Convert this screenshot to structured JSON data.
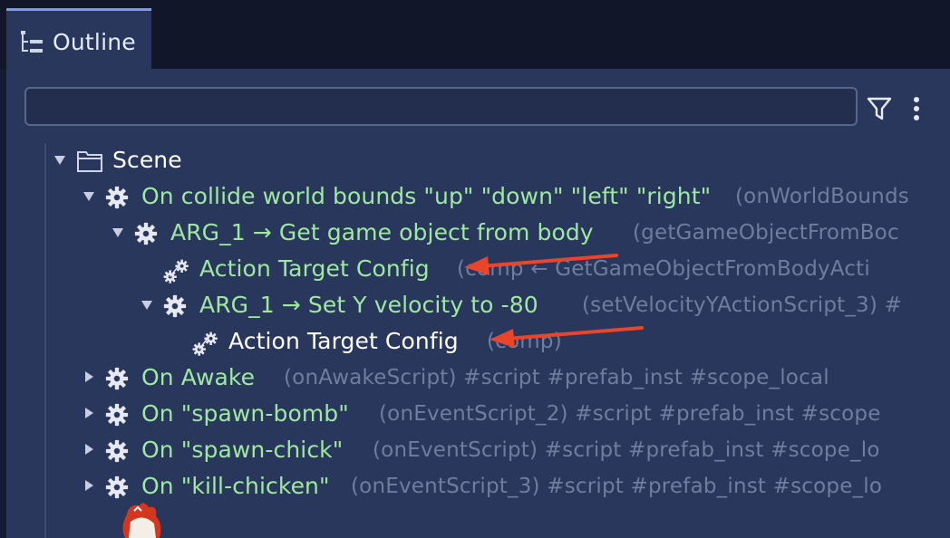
{
  "tab": {
    "label": "Outline"
  },
  "search": {
    "value": "",
    "placeholder": ""
  },
  "tree": {
    "scene": "Scene",
    "rows": [
      {
        "label": "On collide world bounds \"up\" \"down\" \"left\" \"right\"",
        "meta": "(onWorldBounds"
      },
      {
        "label": "ARG_1 → Get game object from body",
        "meta": "(getGameObjectFromBoc"
      },
      {
        "label": "Action Target Config",
        "meta": "(comp ← GetGameObjectFromBodyActi"
      },
      {
        "label": "ARG_1 → Set Y velocity to -80",
        "meta": "(setVelocityYActionScript_3) #"
      },
      {
        "label": "Action Target Config",
        "meta": "(comp)"
      },
      {
        "label": "On Awake",
        "meta": "(onAwakeScript) #script #prefab_inst #scope_local"
      },
      {
        "label": "On \"spawn-bomb\"",
        "meta": "(onEventScript_2) #script #prefab_inst #scope"
      },
      {
        "label": "On \"spawn-chick\"",
        "meta": "(onEventScript) #script #prefab_inst #scope_lo"
      },
      {
        "label": "On \"kill-chicken\"",
        "meta": "(onEventScript_3) #script #prefab_inst #scope_lo"
      }
    ]
  },
  "colors": {
    "panel": "#28375b",
    "script_label": "#9fe8a0",
    "selected_label": "#ffffff",
    "meta_text": "#6f7d9f",
    "annotation_arrow": "#e8452a"
  }
}
